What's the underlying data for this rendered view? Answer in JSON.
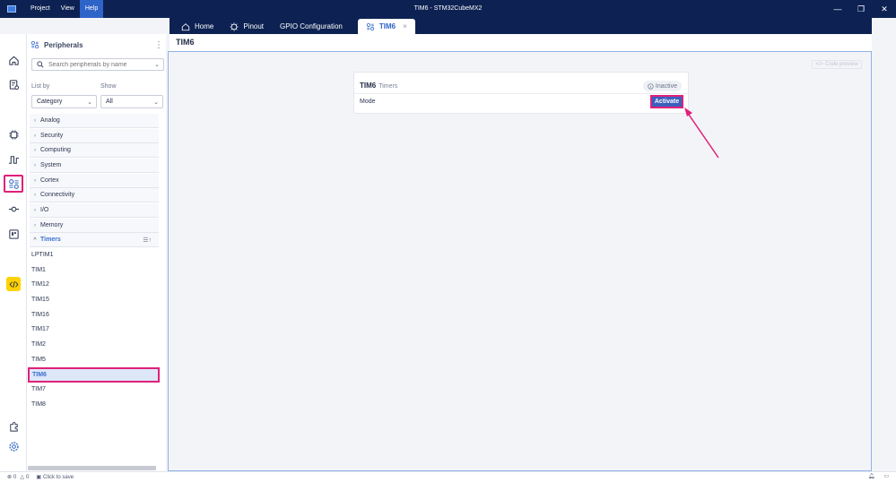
{
  "window": {
    "title": "TIM6 - STM32CubeMX2",
    "menu": [
      "Project",
      "View",
      "Help"
    ],
    "active_menu": "Help",
    "controls": {
      "minimize": "—",
      "maximize": "❐",
      "close": "✕"
    }
  },
  "tabs": [
    {
      "label": "Home",
      "icon": "home-icon"
    },
    {
      "label": "Pinout",
      "icon": "chip-icon"
    },
    {
      "label": "GPIO Configuration",
      "icon": ""
    },
    {
      "label": "TIM6",
      "icon": "peripherals-icon",
      "active": true,
      "close": "×"
    }
  ],
  "rail": [
    "home-icon",
    "project-settings-icon",
    "chip-icon",
    "clock-icon",
    "peripherals-icon",
    "middleware-icon",
    "board-icon",
    "code-icon",
    "extensions-icon",
    "settings-icon"
  ],
  "sidebar": {
    "title": "Peripherals",
    "kebab": "⋮",
    "search_placeholder": "Search peripherals by name",
    "list_by_label": "List by",
    "list_by_value": "Category",
    "show_label": "Show",
    "show_value": "All",
    "categories": [
      "Analog",
      "Security",
      "Computing",
      "System",
      "Cortex",
      "Connectivity",
      "I/O",
      "Memory",
      "Timers"
    ],
    "open_category": "Timers",
    "timers": [
      "LPTIM1",
      "TIM1",
      "TIM12",
      "TIM15",
      "TIM16",
      "TIM17",
      "TIM2",
      "TIM5",
      "TIM6",
      "TIM7",
      "TIM8"
    ],
    "selected_timer": "TIM6"
  },
  "main": {
    "heading": "TIM6",
    "code_preview": "Code preview",
    "card": {
      "name": "TIM6",
      "category": "Timers",
      "status": "Inactive",
      "mode_label": "Mode",
      "activate_label": "Activate"
    }
  },
  "statusbar": {
    "errors": "0",
    "warnings": "0",
    "save": "Click to save"
  },
  "colors": {
    "title_bar": "#0d2252",
    "accent": "#2e63c8",
    "highlight": "#e0207a",
    "code_button": "#ffd200"
  }
}
